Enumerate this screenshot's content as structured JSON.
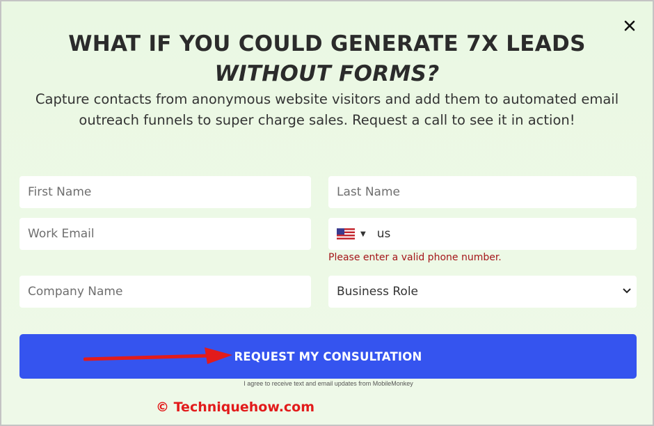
{
  "headline": {
    "line1": "WHAT IF YOU COULD GENERATE 7X LEADS",
    "line2": "WITHOUT FORMS?"
  },
  "subtext": "Capture contacts from anonymous website visitors and add them to automated email outreach funnels to super charge sales. Request a call to see it in action!",
  "form": {
    "first_name_placeholder": "First Name",
    "last_name_placeholder": "Last Name",
    "work_email_placeholder": "Work Email",
    "phone_value": "us",
    "phone_country_icon": "us-flag-icon",
    "phone_error": "Please enter a valid phone number.",
    "company_name_placeholder": "Company Name",
    "business_role_selected": "Business Role",
    "submit_label": "REQUEST MY CONSULTATION",
    "consent": "I agree to receive text and email updates from MobileMonkey"
  },
  "watermark": "© Techniquehow.com",
  "colors": {
    "background": "#ecf9e5",
    "button": "#3554ef",
    "error": "#a4161a",
    "arrow": "#e21b1b"
  }
}
